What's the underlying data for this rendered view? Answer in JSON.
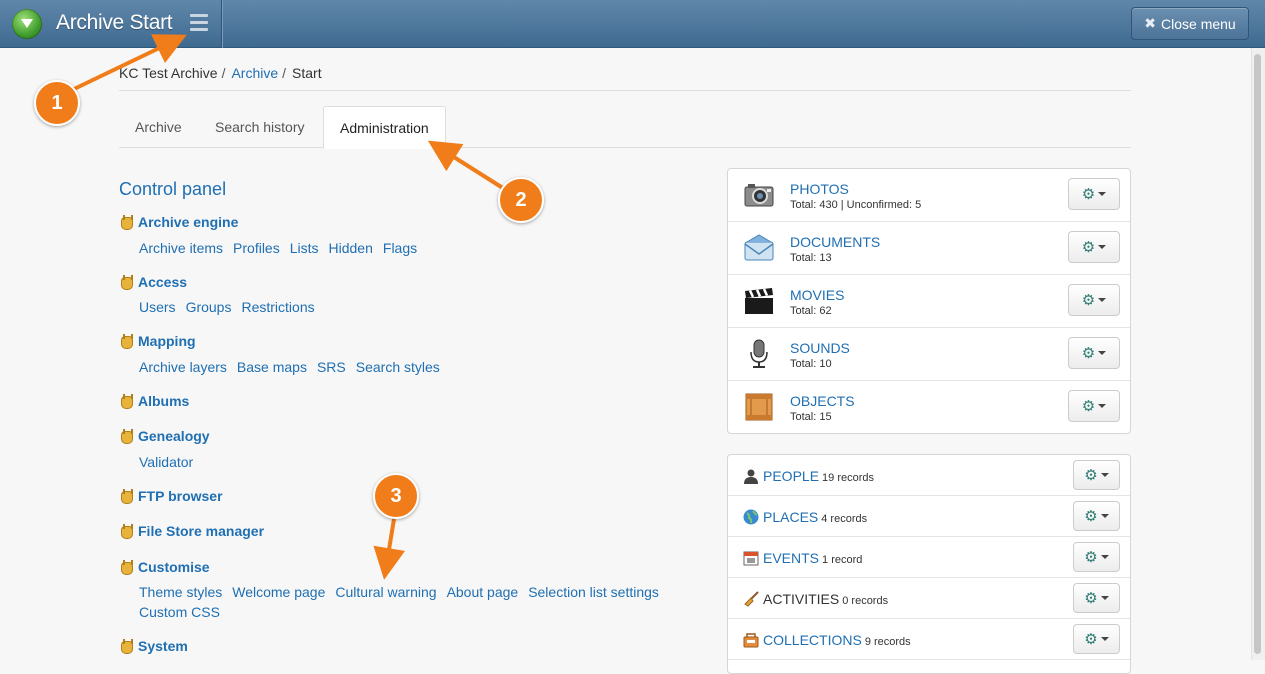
{
  "header": {
    "title": "Archive Start",
    "close_menu_label": "Close menu"
  },
  "breadcrumb": {
    "root": "KC Test Archive",
    "link": "Archive",
    "current": "Start",
    "separator": "/"
  },
  "tabs": [
    {
      "label": "Archive",
      "active": false
    },
    {
      "label": "Search history",
      "active": false
    },
    {
      "label": "Administration",
      "active": true
    }
  ],
  "control_panel": {
    "title": "Control panel",
    "sections": [
      {
        "title": "Archive engine",
        "links": [
          "Archive items",
          "Profiles",
          "Lists",
          "Hidden",
          "Flags"
        ]
      },
      {
        "title": "Access",
        "links": [
          "Users",
          "Groups",
          "Restrictions"
        ]
      },
      {
        "title": "Mapping",
        "links": [
          "Archive layers",
          "Base maps",
          "SRS",
          "Search styles"
        ]
      },
      {
        "title": "Albums",
        "links": []
      },
      {
        "title": "Genealogy",
        "links": [
          "Validator"
        ]
      },
      {
        "title": "FTP browser",
        "links": []
      },
      {
        "title": "File Store manager",
        "links": []
      },
      {
        "title": "Customise",
        "links": [
          "Theme styles",
          "Welcome page",
          "Cultural warning",
          "About page",
          "Selection list settings"
        ],
        "links_line2": [
          "Custom CSS"
        ]
      },
      {
        "title": "System",
        "links": []
      }
    ]
  },
  "media": [
    {
      "name": "PHOTOS",
      "total": "Total: 430 | Unconfirmed: 5",
      "icon": "camera-icon"
    },
    {
      "name": "DOCUMENTS",
      "total": "Total: 13",
      "icon": "envelope-icon"
    },
    {
      "name": "MOVIES",
      "total": "Total: 62",
      "icon": "clapperboard-icon"
    },
    {
      "name": "SOUNDS",
      "total": "Total: 10",
      "icon": "microphone-icon"
    },
    {
      "name": "OBJECTS",
      "total": "Total: 15",
      "icon": "crate-icon"
    }
  ],
  "records": [
    {
      "name": "PEOPLE",
      "count": "19 records",
      "icon": "person-icon",
      "link": true
    },
    {
      "name": "PLACES",
      "count": "4 records",
      "icon": "globe-icon",
      "link": true
    },
    {
      "name": "EVENTS",
      "count": "1 record",
      "icon": "calendar-icon",
      "link": true
    },
    {
      "name": "ACTIVITIES",
      "count": "0 records",
      "icon": "broom-icon",
      "link": false
    },
    {
      "name": "COLLECTIONS",
      "count": "9 records",
      "icon": "collection-icon",
      "link": true
    }
  ],
  "callouts": [
    "1",
    "2",
    "3"
  ],
  "colors": {
    "topbar": "#4f7aa0",
    "link": "#1f6fb2",
    "callout": "#f07d1a",
    "gear": "#2f7d74"
  }
}
